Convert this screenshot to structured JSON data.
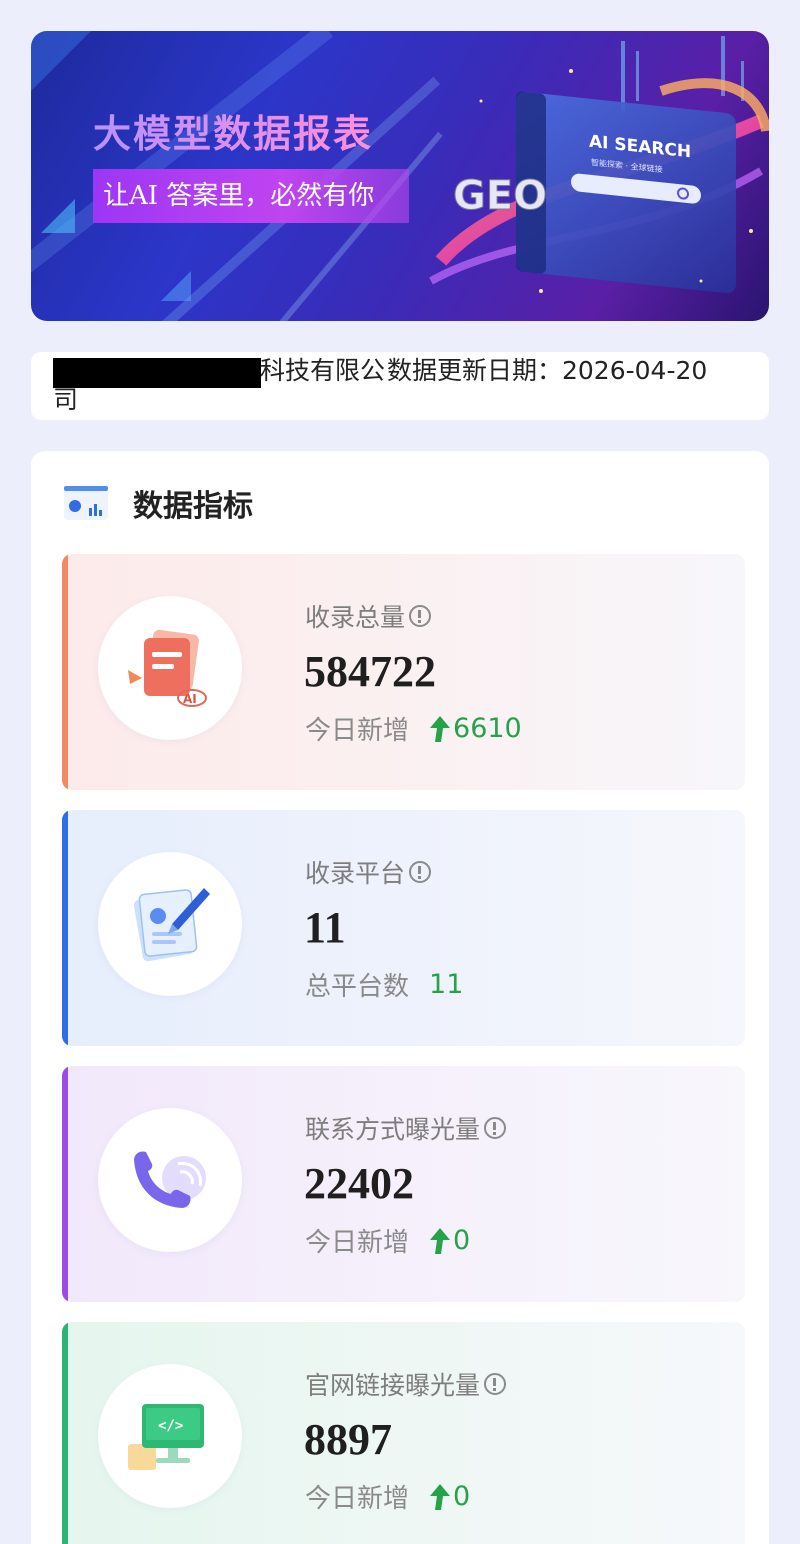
{
  "banner": {
    "title": "大模型数据报表",
    "subtitle": "让AI 答案里，必然有你",
    "art_text": {
      "geo": "GEO",
      "ai_search": "AI SEARCH",
      "ai_search_sub": "智能探索 · 全球链接"
    }
  },
  "info": {
    "company_suffix": "科技有限公司",
    "update_label": "数据更新日期：2026-04-20"
  },
  "metrics": {
    "title": "数据指标",
    "title_icon": "chart-icon",
    "cards": [
      {
        "label": "收录总量",
        "value": "584722",
        "sub_label": "今日新增",
        "sub_value": "6610",
        "has_arrow": true,
        "icon": "ai-document-icon",
        "accent": "#ef8a67"
      },
      {
        "label": "收录平台",
        "value": "11",
        "sub_label": "总平台数",
        "sub_value": "11",
        "has_arrow": false,
        "icon": "document-pen-icon",
        "accent": "#2f6de4"
      },
      {
        "label": "联系方式曝光量",
        "value": "22402",
        "sub_label": "今日新增",
        "sub_value": "0",
        "has_arrow": true,
        "icon": "phone-icon",
        "accent": "#9a4de6"
      },
      {
        "label": "官网链接曝光量",
        "value": "8897",
        "sub_label": "今日新增",
        "sub_value": "0",
        "has_arrow": true,
        "icon": "code-monitor-icon",
        "accent": "#2db374"
      }
    ]
  },
  "colors": {
    "increase": "#26a24a",
    "background": "#eceffb"
  }
}
